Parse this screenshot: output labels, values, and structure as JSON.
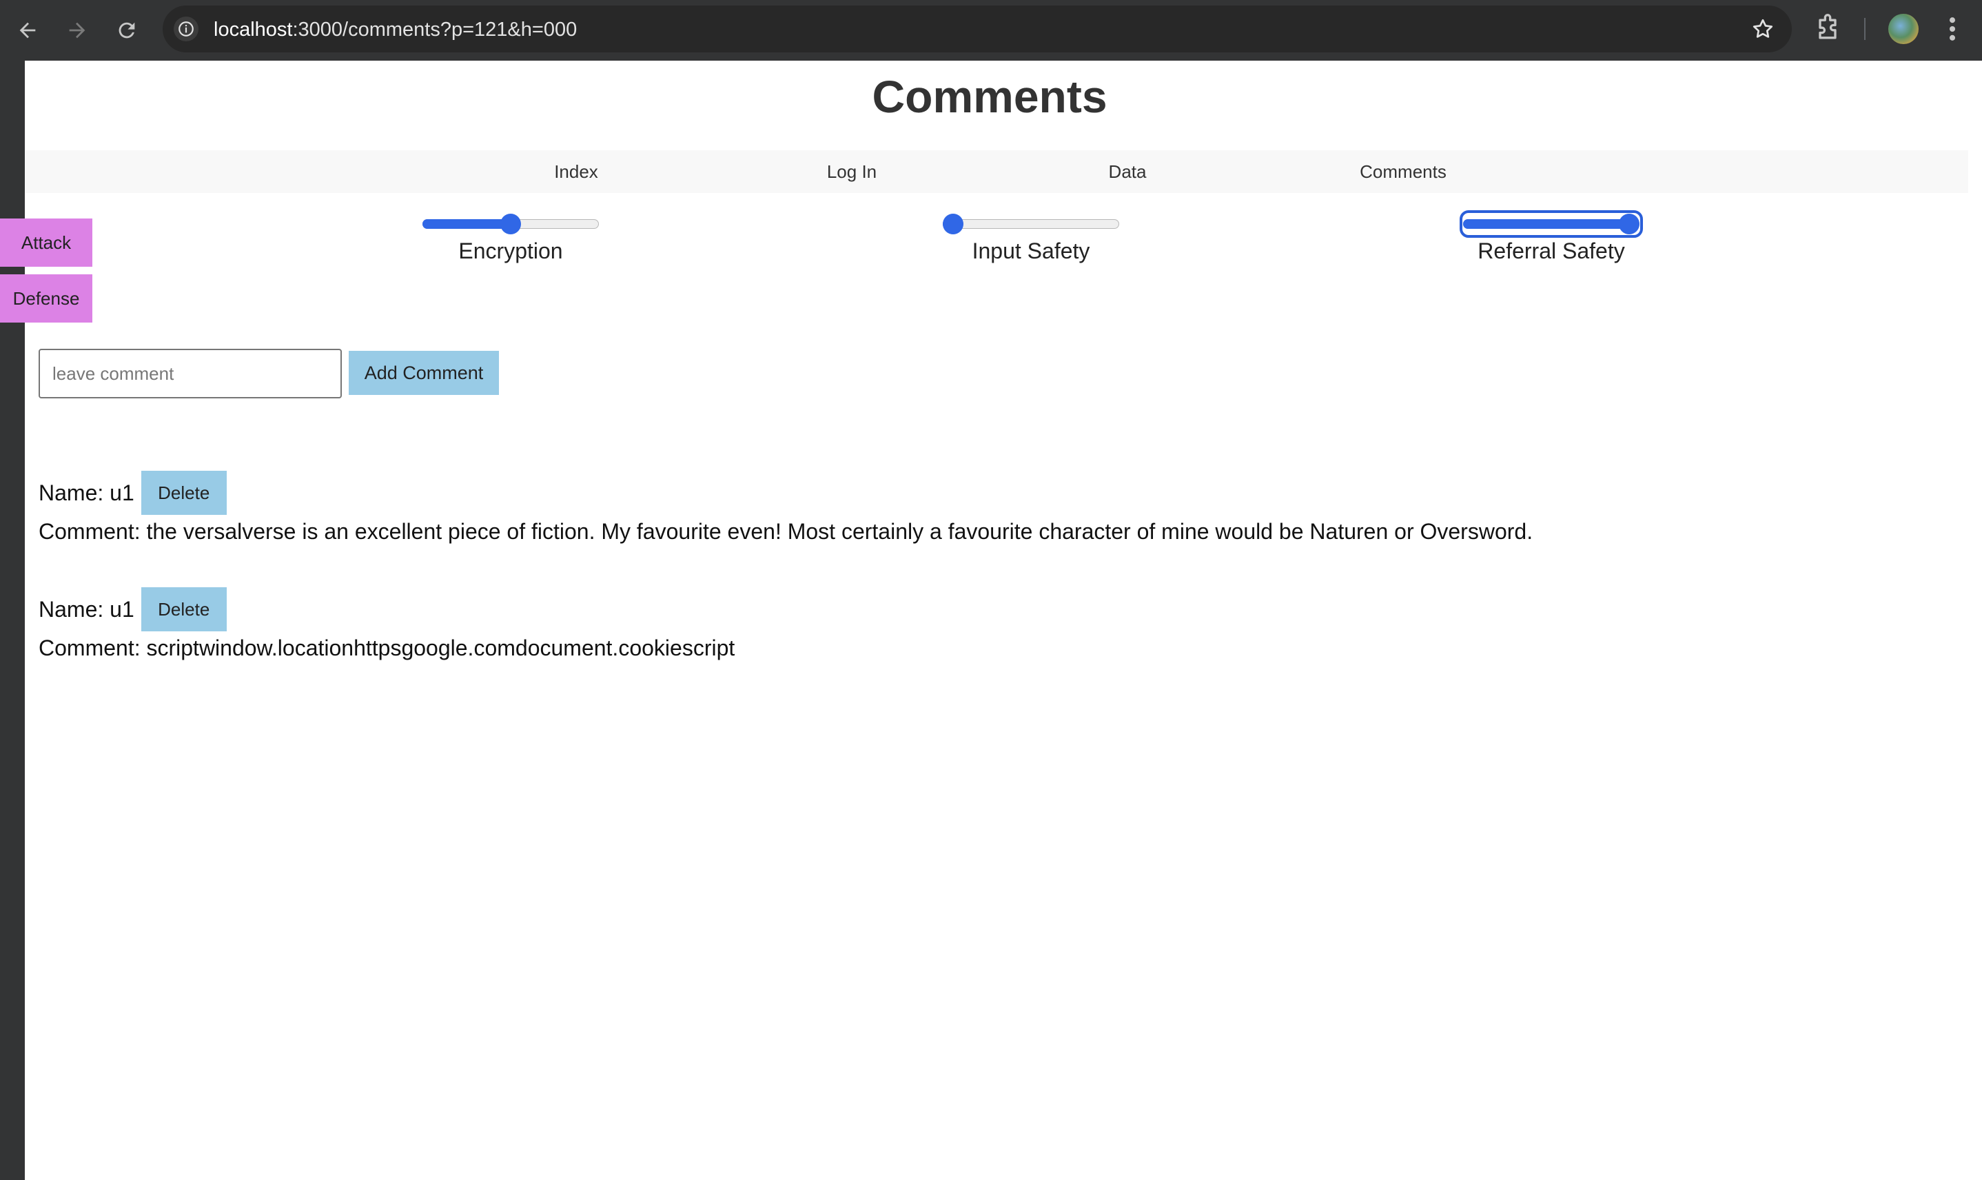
{
  "browser": {
    "url_host": "localhost",
    "url_rest": ":3000/comments?p=121&h=000"
  },
  "page": {
    "title": "Comments"
  },
  "nav": {
    "items": [
      "Index",
      "Log In",
      "Data",
      "Comments"
    ]
  },
  "side_buttons": {
    "attack_label": "Attack",
    "defense_label": "Defense"
  },
  "sliders": [
    {
      "label": "Encryption",
      "level": 0.5
    },
    {
      "label": "Input Safety",
      "level": 0.0
    },
    {
      "label": "Referral Safety",
      "level": 1.0
    }
  ],
  "comment_form": {
    "placeholder": "leave comment",
    "submit_label": "Add Comment"
  },
  "comments": [
    {
      "name": "Name: u1",
      "delete_label": "Delete",
      "text": "Comment: the versalverse is an excellent piece of fiction. My favourite even! Most certainly a favourite character of mine would be Naturen or Oversword."
    },
    {
      "name": "Name: u1",
      "delete_label": "Delete",
      "text": "Comment: scriptwindow.locationhttpsgoogle.comdocument.cookiescript"
    }
  ],
  "colors": {
    "side_button": "#dc82e5",
    "action_button": "#98cbe6",
    "slider_accent": "#3067e6"
  }
}
